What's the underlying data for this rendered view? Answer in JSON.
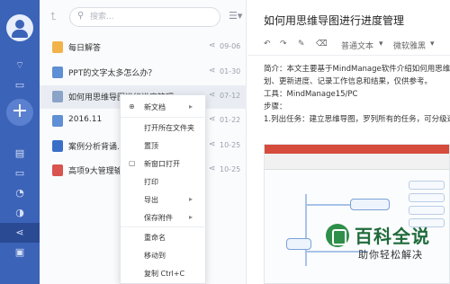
{
  "rail": {
    "items": [
      "wifi-icon",
      "folder-icon",
      "file-stack-icon",
      "person-icon",
      "users-icon",
      "share-icon",
      "calendar-icon"
    ]
  },
  "search": {
    "placeholder": "搜索..."
  },
  "files": [
    {
      "name": "每日解答",
      "date": "09-06",
      "type": "folder"
    },
    {
      "name": "PPT的文字太多怎么办？",
      "date": "01-30",
      "type": "ppt"
    },
    {
      "name": "如何用思维导图进行进度管理",
      "date": "07-12",
      "type": "mind"
    },
    {
      "name": "2016.11",
      "date": "01-22",
      "type": "ppt"
    },
    {
      "name": "案例分析背诵.docx",
      "date": "10-25",
      "type": "word"
    },
    {
      "name": "高项9大管理输入输出",
      "date": "10-25",
      "type": "pdf"
    }
  ],
  "menu": {
    "new_doc": "新文档",
    "open_folder": "打开所在文件夹",
    "pin": "置顶",
    "new_window": "新窗口打开",
    "print": "打印",
    "export": "导出",
    "save_attachment": "保存附件",
    "rename": "重命名",
    "move_to": "移动到",
    "copy": "复制 Ctrl+C"
  },
  "editor": {
    "title": "如何用思维导图进行进度管理",
    "style": "普通文本",
    "font": "微软雅黑",
    "lines": [
      "简介：本文主要基于MindManage软件介绍如何用思维导图",
      "划、更新进度、记录工作信息和结果，仅供参考。",
      "工具：MindManage15/PC",
      "步骤：",
      "1.列出任务：建立思维导图，罗列所有的任务，可分级逐一"
    ]
  },
  "watermark": {
    "title": "百科全说",
    "subtitle": "助你轻松解决"
  },
  "colors": {
    "rail": "#3b63b8",
    "accent": "#2a4a94"
  }
}
